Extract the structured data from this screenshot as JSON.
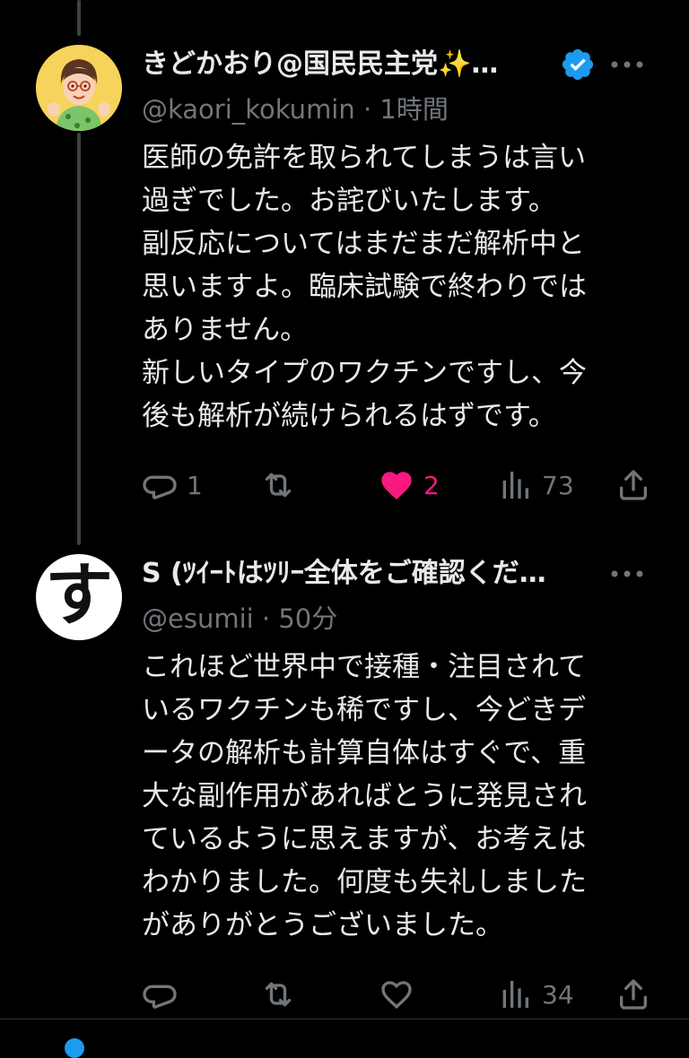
{
  "tweets": [
    {
      "display_name": "きどかおり@国民民主党✨…",
      "handle": "@kaori_kokumin",
      "time": "1時間",
      "text": "医師の免許を取られてしまうは言い\n過ぎでした。お詫びいたします。\n副反応についてはまだまだ解析中と\n思いますよ。臨床試験で終わりでは\nありません。\n新しいタイプのワクチンですし、今\n後も解析が続けられるはずです。",
      "replies": "1",
      "retweets": "",
      "likes": "2",
      "liked": true,
      "views": "73",
      "verified": true
    },
    {
      "display_name": "S (ﾂｲｰﾄはﾂﾘｰ全体をご確認くだ…",
      "handle": "@esumii",
      "time": "50分",
      "avatar_glyph": "す",
      "text": "これほど世界中で接種・注目されて\nいるワクチンも稀ですし、今どきデ\nータの解析も計算自体はすぐで、重\n大な副作用があればとうに発見され\nているように思えますが、お考えは\nわかりました。何度も失礼しました\nがありがとうございました。",
      "replies": "",
      "retweets": "",
      "likes": "",
      "liked": false,
      "views": "34",
      "verified": false
    }
  ],
  "separator": "·",
  "colors": {
    "background": "#000000",
    "text": "#e7e9ea",
    "muted": "#71767b",
    "like_pink": "#f91880",
    "verified_blue": "#1d9bf0"
  }
}
